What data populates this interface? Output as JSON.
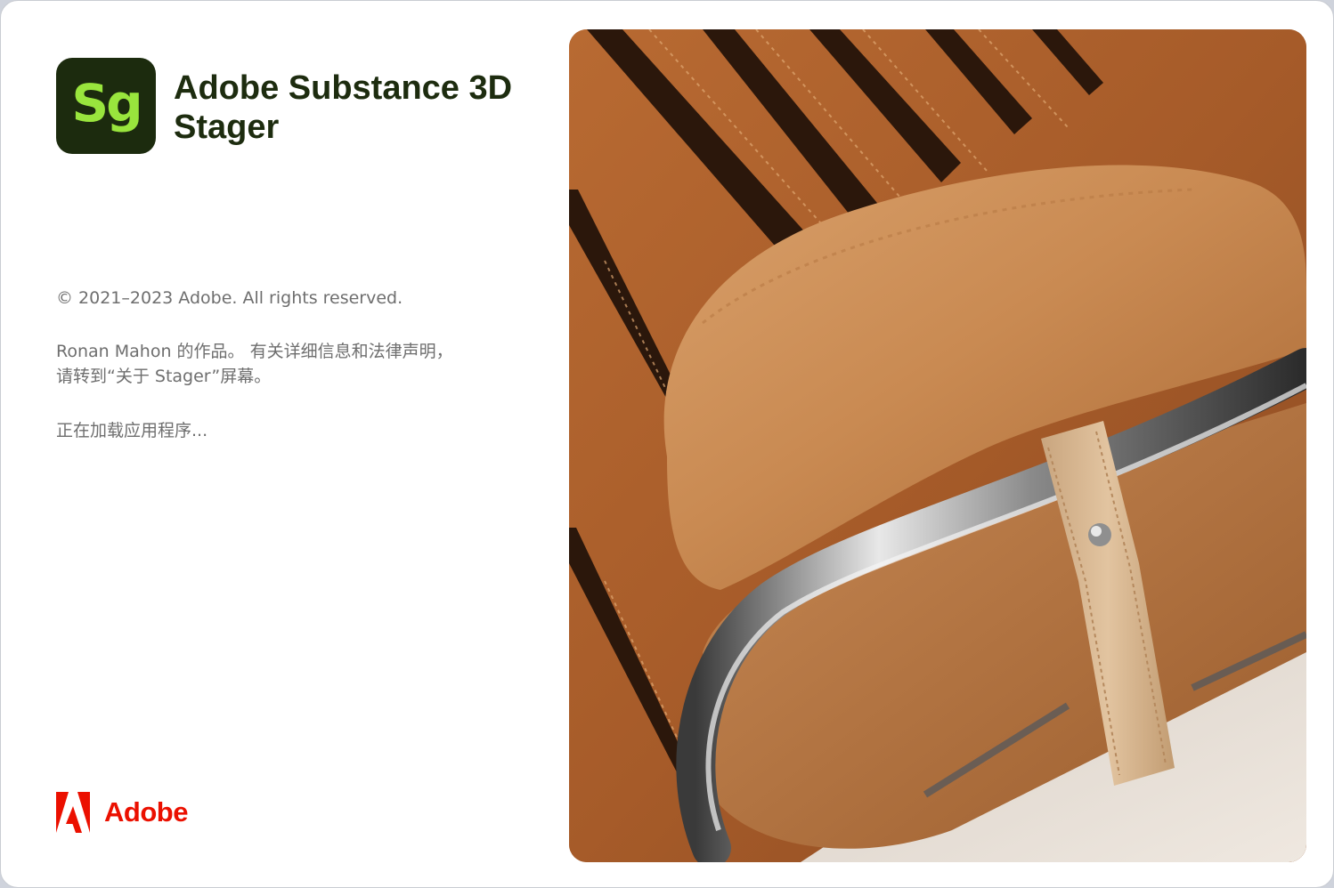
{
  "app_icon": {
    "abbr": "Sg",
    "background": "#1c2b0e",
    "letters_color": "#99e53d"
  },
  "product_name": {
    "line1": "Adobe Substance 3D",
    "line2": "Stager"
  },
  "copyright": "© 2021–2023 Adobe. All rights reserved.",
  "credit": {
    "line1": "Ronan Mahon 的作品。 有关详细信息和法律声明，",
    "line2": "请转到“关于 Stager”屏幕。"
  },
  "status": "正在加载应用程序...",
  "brand": {
    "label": "Adobe",
    "color": "#eb1000",
    "icon": "adobe-logo-icon"
  },
  "artwork": {
    "subject": "leather-chair-artwork-image"
  }
}
